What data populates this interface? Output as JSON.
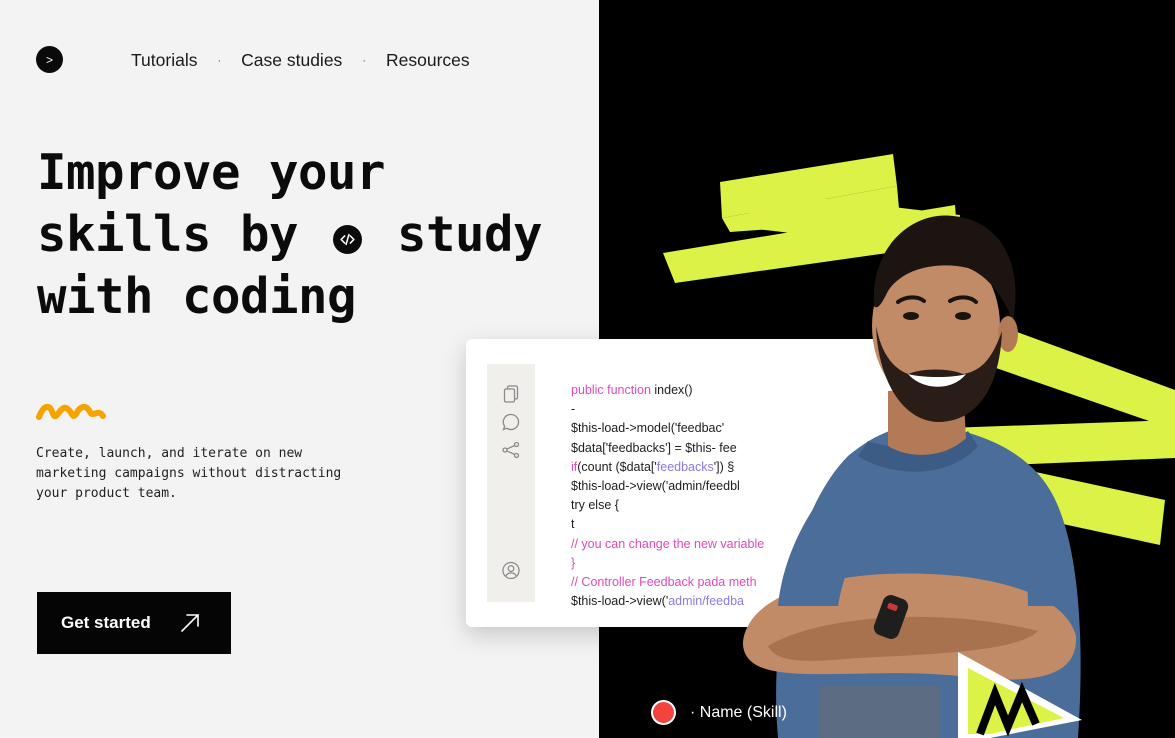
{
  "nav": {
    "logo_glyph": ">",
    "items": [
      "Tutorials",
      "Case studies",
      "Resources"
    ],
    "separator": "·"
  },
  "hero": {
    "line1": "Improve your",
    "line2a": "skills by",
    "line2b": "study",
    "line3": "with coding",
    "badge_icon": "code-icon"
  },
  "description": "Create, launch, and iterate on new marketing campaigns without distracting your product team.",
  "cta": {
    "label": "Get started",
    "icon": "arrow-up-right-icon"
  },
  "editor": {
    "rail_icons": [
      "copy-icon",
      "comment-icon",
      "share-icon",
      "user-icon"
    ],
    "lines": [
      {
        "parts": [
          {
            "t": "public function ",
            "c": "pink"
          },
          {
            "t": "index()",
            "c": ""
          }
        ]
      },
      {
        "parts": [
          {
            "t": "-",
            "c": ""
          }
        ]
      },
      {
        "parts": [
          {
            "t": "$this-load->model('feedbac'",
            "c": ""
          }
        ]
      },
      {
        "parts": [
          {
            "t": "$data['feedbacks'] = $this- fee",
            "c": ""
          }
        ]
      },
      {
        "parts": [
          {
            "t": "if",
            "c": "pink"
          },
          {
            "t": "(count ($data['",
            "c": ""
          },
          {
            "t": "feedbacks",
            "c": "purple"
          },
          {
            "t": "']) §",
            "c": ""
          }
        ]
      },
      {
        "parts": [
          {
            "t": "$this-load->view('admin/feedbl",
            "c": ""
          }
        ]
      },
      {
        "parts": [
          {
            "t": "try else {",
            "c": ""
          }
        ]
      },
      {
        "parts": [
          {
            "t": "t",
            "c": ""
          }
        ]
      },
      {
        "parts": [
          {
            "t": "// you can change the new variable",
            "c": "pink"
          }
        ]
      },
      {
        "parts": [
          {
            "t": "}",
            "c": "pink"
          }
        ]
      },
      {
        "parts": [
          {
            "t": "// Controller Feedback pada meth",
            "c": "pink"
          }
        ]
      },
      {
        "parts": [
          {
            "t": "$this-load->view('",
            "c": ""
          },
          {
            "t": "admin/feedba",
            "c": "purple"
          }
        ]
      }
    ]
  },
  "namebar": {
    "label": "· Name (Skill)"
  },
  "colors": {
    "accent": "#DDF247",
    "dark": "#000000",
    "light": "#F3F3F3",
    "rec": "#F1443F"
  }
}
